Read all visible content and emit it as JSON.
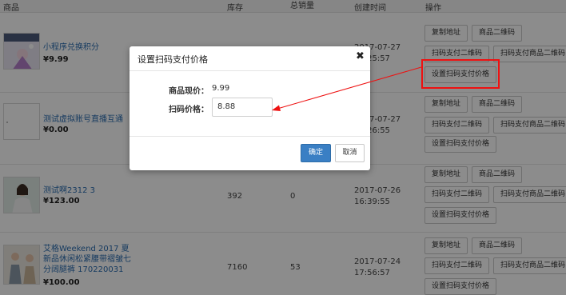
{
  "table": {
    "headers": {
      "product": "商品",
      "stock": "库存",
      "sales": "总销量",
      "created": "创建时间",
      "actions": "操作"
    },
    "rows": [
      {
        "name": "小程序兑换积分",
        "price": "¥9.99",
        "stock": "",
        "sales": "",
        "date": "2017-07-27",
        "time": "16:25:57",
        "actions": [
          "复制地址",
          "商品二维码",
          "扫码支付二维码",
          "扫码支付商品二维码",
          "设置扫码支付价格"
        ]
      },
      {
        "name": "测试虚拟账号直播互通",
        "price": "¥0.00",
        "stock": "",
        "sales": "",
        "date": "2017-07-27",
        "time": "16:26:55",
        "actions": [
          "复制地址",
          "商品二维码",
          "扫码支付二维码",
          "扫码支付商品二维码",
          "设置扫码支付价格"
        ]
      },
      {
        "name": "测试啊2312 3",
        "price": "¥123.00",
        "stock": "392",
        "sales": "0",
        "date": "2017-07-26",
        "time": "16:39:55",
        "actions": [
          "复制地址",
          "商品二维码",
          "扫码支付二维码",
          "扫码支付商品二维码",
          "设置扫码支付价格"
        ]
      },
      {
        "name": "艾格Weekend 2017 夏新品休闲松紧腰带褶皱七分阔腿裤 170220031",
        "price": "¥100.00",
        "stock": "7160",
        "sales": "53",
        "date": "2017-07-24",
        "time": "17:56:57",
        "actions": [
          "复制地址",
          "商品二维码",
          "扫码支付二维码",
          "扫码支付商品二维码",
          "设置扫码支付价格"
        ]
      }
    ]
  },
  "dialog": {
    "title": "设置扫码支付价格",
    "close": "✖",
    "current_price_label": "商品现价：",
    "current_price_value": "9.99",
    "scan_price_label": "扫码价格：",
    "scan_price_value": "8.88",
    "ok": "确定",
    "cancel": "取消"
  },
  "colors": {
    "annotation": "#ee1111",
    "primary_button": "#3a7fc4",
    "link": "#2a6cb0"
  }
}
